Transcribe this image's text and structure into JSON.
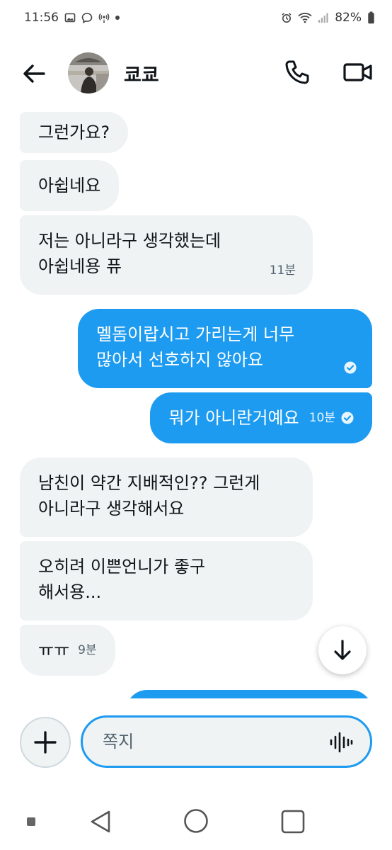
{
  "status_bar": {
    "time": "11:56",
    "battery": "82%"
  },
  "header": {
    "contact_name": "쿄쿄"
  },
  "messages": [
    {
      "dir": "in",
      "text": "그런가요?"
    },
    {
      "dir": "in",
      "text": "아쉽네요"
    },
    {
      "dir": "in",
      "text": "저는 아니라구 생각했는데\n아쉽네용 퓨",
      "time": "11분"
    },
    {
      "dir": "out",
      "text": "멜돔이랍시고 가리는게 너무\n많아서 선호하지 않아요"
    },
    {
      "dir": "out",
      "text": "뭐가 아니란거예요",
      "time": "10분"
    },
    {
      "dir": "in",
      "text": "남친이 약간 지배적인?? 그런게\n아니라구 생각해서요"
    },
    {
      "dir": "in",
      "text": "오히려 이쁜언니가 좋구\n해서용..."
    },
    {
      "dir": "in",
      "text": "ㅠㅠ",
      "time": "9분"
    }
  ],
  "composer": {
    "placeholder": "쪽지"
  },
  "colors": {
    "accent": "#1d9bf0",
    "incoming_bg": "#eff3f4"
  },
  "icons": {
    "back": "arrow-left-icon",
    "call": "phone-icon",
    "video": "video-camera-icon",
    "add": "plus-icon",
    "voice": "voice-waveform-icon",
    "scroll": "arrow-down-icon"
  }
}
